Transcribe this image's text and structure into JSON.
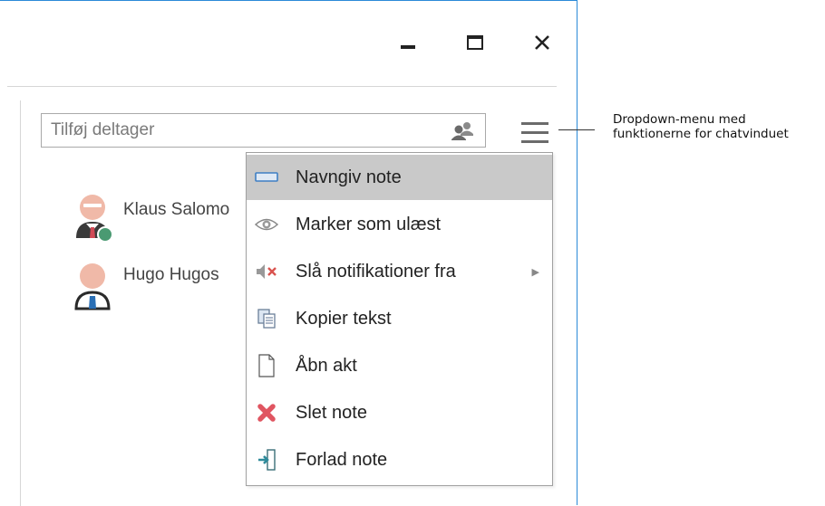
{
  "window": {
    "controls": {
      "minimize": "minimize-icon",
      "maximize": "maximize-icon",
      "close": "close-icon"
    }
  },
  "search": {
    "placeholder": "Tilføj deltager",
    "value": "",
    "icon": "add-participant-icon"
  },
  "menu_button": {
    "icon": "hamburger-icon"
  },
  "participants": [
    {
      "name": "Klaus Salomo",
      "status_color": "#4a9a72"
    },
    {
      "name": "Hugo Hugos"
    }
  ],
  "menu": {
    "items": [
      {
        "label": "Navngiv note",
        "icon": "rename-icon",
        "highlighted": true
      },
      {
        "label": "Marker som ulæst",
        "icon": "eye-icon"
      },
      {
        "label": "Slå notifikationer fra",
        "icon": "mute-icon",
        "submenu": true
      },
      {
        "label": "Kopier tekst",
        "icon": "copy-icon"
      },
      {
        "label": "Åbn akt",
        "icon": "document-icon"
      },
      {
        "label": "Slet note",
        "icon": "delete-icon"
      },
      {
        "label": "Forlad note",
        "icon": "leave-icon"
      }
    ]
  },
  "annotation": {
    "line1": "Dropdown-menu med",
    "line2": "funktionerne for chatvinduet"
  },
  "colors": {
    "accent": "#2b8ad8",
    "highlight": "#c9c9c9",
    "delete": "#e05561",
    "leave": "#2e8a9a"
  }
}
